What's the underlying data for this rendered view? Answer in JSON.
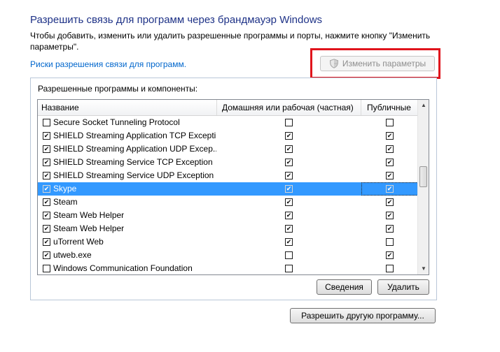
{
  "header": {
    "title": "Разрешить связь для программ через брандмауэр Windows",
    "description": "Чтобы добавить, изменить или удалить разрешенные программы и порты, нажмите кнопку \"Изменить параметры\".",
    "risk_link": "Риски разрешения связи для программ.",
    "change_settings_label": "Изменить параметры"
  },
  "group": {
    "label": "Разрешенные программы и компоненты:"
  },
  "columns": {
    "name": "Название",
    "home": "Домашняя или рабочая (частная)",
    "public": "Публичные"
  },
  "rows": [
    {
      "name": "Secure Socket Tunneling Protocol",
      "enabled": false,
      "home": false,
      "public": false
    },
    {
      "name": "SHIELD Streaming Application TCP Excepti...",
      "enabled": true,
      "home": true,
      "public": true
    },
    {
      "name": "SHIELD Streaming Application UDP Excep...",
      "enabled": true,
      "home": true,
      "public": true
    },
    {
      "name": "SHIELD Streaming Service TCP Exception",
      "enabled": true,
      "home": true,
      "public": true
    },
    {
      "name": "SHIELD Streaming Service UDP Exception",
      "enabled": true,
      "home": true,
      "public": true
    },
    {
      "name": "Skype",
      "enabled": true,
      "home": true,
      "public": true,
      "selected": true
    },
    {
      "name": "Steam",
      "enabled": true,
      "home": true,
      "public": true
    },
    {
      "name": "Steam Web Helper",
      "enabled": true,
      "home": true,
      "public": true
    },
    {
      "name": "Steam Web Helper",
      "enabled": true,
      "home": true,
      "public": true
    },
    {
      "name": "uTorrent Web",
      "enabled": true,
      "home": true,
      "public": false
    },
    {
      "name": "utweb.exe",
      "enabled": true,
      "home": false,
      "public": true
    },
    {
      "name": "Windows Communication Foundation",
      "enabled": false,
      "home": false,
      "public": false
    }
  ],
  "buttons": {
    "details": "Сведения",
    "delete": "Удалить",
    "allow_other": "Разрешить другую программу..."
  },
  "colors": {
    "title": "#1e3287",
    "link": "#0066cc",
    "selection": "#3399ff",
    "highlight_frame": "#e0141c"
  },
  "icons": {
    "change_settings": "uac-shield-icon",
    "scroll_up": "scroll-up-arrow-icon",
    "scroll_down": "scroll-down-arrow-icon"
  }
}
